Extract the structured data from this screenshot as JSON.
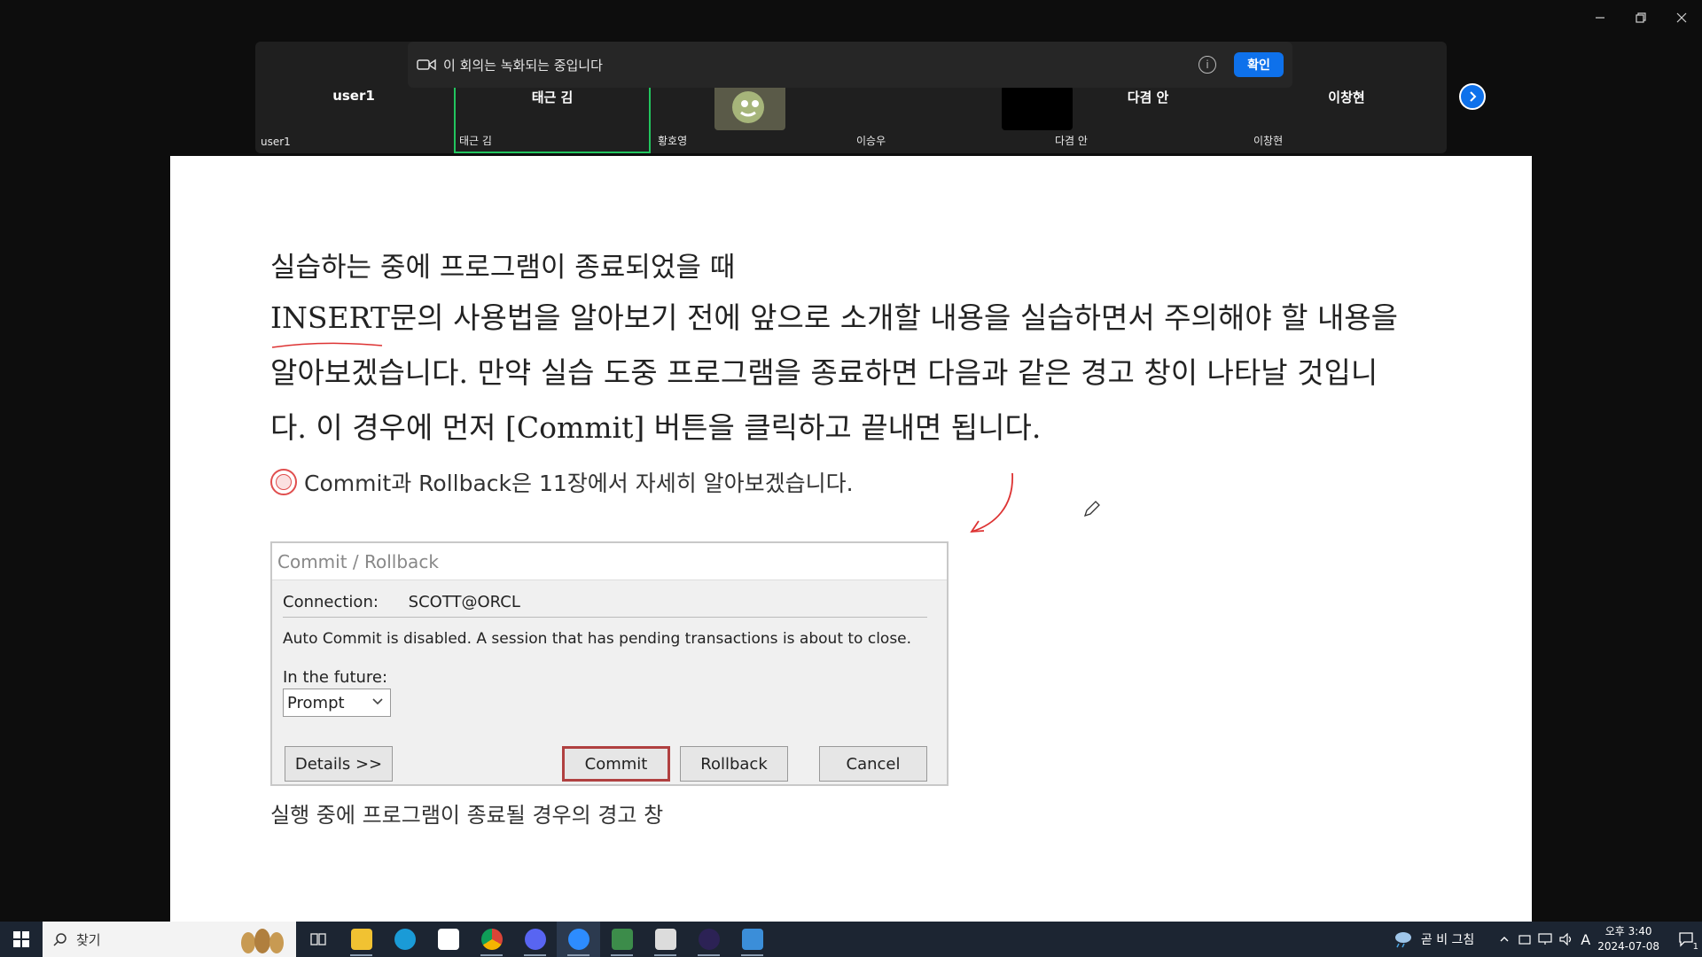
{
  "window": {
    "minimize": "minimize",
    "restore": "restore",
    "close": "close"
  },
  "recording_banner": {
    "text": "이 회의는 녹화되는 중입니다",
    "info": "i",
    "confirm_label": "확인"
  },
  "participants": [
    {
      "center_name": "user1",
      "label": "user1"
    },
    {
      "center_name": "태근 김",
      "label": "태근 김",
      "active": true
    },
    {
      "center_name": "",
      "label": "황호영"
    },
    {
      "center_name": "",
      "label": "이승우"
    },
    {
      "center_name": "다겸 안",
      "label": "다겸 안"
    },
    {
      "center_name": "이창현",
      "label": "이창현"
    }
  ],
  "content": {
    "heading": "실습하는 중에 프로그램이 종료되었을 때",
    "body": "INSERT문의 사용법을 알아보기 전에 앞으로 소개할 내용을 실습하면서 주의해야 할 내용을 알아보겠습니다. 만약 실습 도중 프로그램을 종료하면 다음과 같은 경고 창이 나타날 것입니다. 이 경우에 먼저 [Commit] 버튼을 클릭하고 끝내면 됩니다.",
    "note": "Commit과 Rollback은 11장에서 자세히 알아보겠습니다.",
    "caption": "실행 중에 프로그램이 종료될 경우의 경고 창"
  },
  "dialog": {
    "title": "Commit / Rollback",
    "connection_label": "Connection:",
    "connection_value": "SCOTT@ORCL",
    "message": "Auto Commit is disabled.  A session that has pending transactions is about to close.",
    "future_label": "In the future:",
    "future_value": "Prompt",
    "details_button": "Details >>",
    "commit_button": "Commit",
    "rollback_button": "Rollback",
    "cancel_button": "Cancel"
  },
  "taskbar": {
    "search_placeholder": "찾기",
    "weather": "곧 비 그침",
    "ime": "A",
    "time": "오후 3:40",
    "date": "2024-07-08",
    "notification_count": "1"
  }
}
